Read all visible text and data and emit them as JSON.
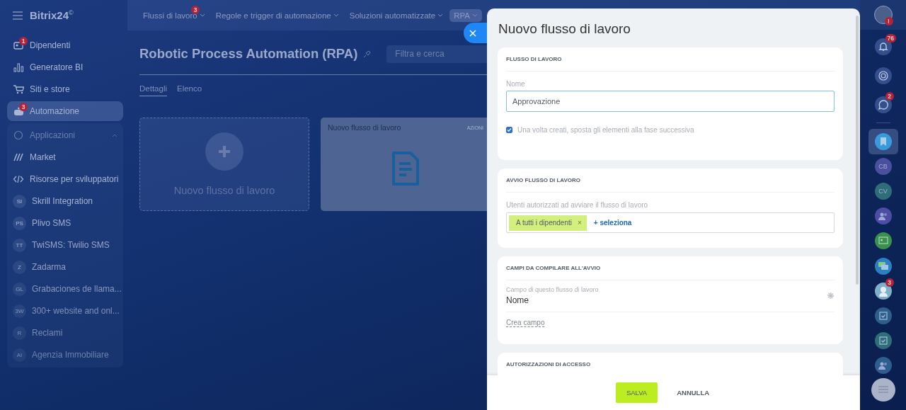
{
  "logo": {
    "name": "Bitrix24",
    "mark": "©"
  },
  "sidebar": {
    "items": [
      {
        "label": "Dipendenti",
        "badge": "1",
        "selected": false
      },
      {
        "label": "Generatore BI",
        "selected": false
      },
      {
        "label": "Siti e store",
        "selected": false
      },
      {
        "label": "Automazione",
        "badge": "3",
        "selected": true
      }
    ],
    "group": {
      "label": "Applicazioni",
      "expanded": true,
      "items": [
        {
          "label": "Market",
          "kind": "icon"
        },
        {
          "label": "Risorse per sviluppatori",
          "kind": "icon"
        },
        {
          "label": "Skrill Integration",
          "kind": "initials",
          "initials": "SI"
        },
        {
          "label": "Plivo SMS",
          "kind": "initials",
          "initials": "PS"
        },
        {
          "label": "TwiSMS: Twilio SMS",
          "kind": "initials",
          "initials": "TT"
        },
        {
          "label": "Zadarma",
          "kind": "initials",
          "initials": "Z"
        },
        {
          "label": "Grabaciones de llama...",
          "kind": "initials",
          "initials": "GL"
        },
        {
          "label": "300+ website and onl...",
          "kind": "initials",
          "initials": "3W"
        },
        {
          "label": "Reclami",
          "kind": "initials",
          "initials": "R"
        },
        {
          "label": "Agenzia Immobiliare",
          "kind": "initials",
          "initials": "AI"
        }
      ]
    }
  },
  "top_nav": [
    {
      "label": "Flussi di lavoro",
      "badge": "3",
      "selected": false
    },
    {
      "label": "Regole e trigger di automazione",
      "selected": false
    },
    {
      "label": "Soluzioni automatizzate",
      "selected": false
    },
    {
      "label": "RPA",
      "selected": true
    }
  ],
  "page": {
    "title": "Robotic Process Automation (RPA)",
    "search": {
      "placeholder": "Filtra e cerca"
    },
    "tabs": [
      {
        "label": "Dettagli",
        "selected": true
      },
      {
        "label": "Elenco",
        "selected": false
      }
    ],
    "add_card": {
      "label": "Nuovo flusso di lavoro"
    },
    "workflow_card": {
      "title": "Nuovo flusso di lavoro",
      "actions": "AZIONI"
    }
  },
  "panel": {
    "title": "Nuovo flusso di lavoro",
    "sections": [
      {
        "kind": "name",
        "title": "FLUSSO DI LAVORO",
        "label": "Nome",
        "value": "Approvazione",
        "checkbox": {
          "label": "Una volta creati, sposta gli elementi alla fase successiva",
          "checked": true
        }
      },
      {
        "kind": "users",
        "title": "AVVIO FLUSSO DI LAVORO",
        "label": "Utenti autorizzati ad avviare il flusso di lavoro",
        "tags": [
          "A tutti i dipendenti"
        ],
        "remove": "×",
        "add": "+ seleziona"
      },
      {
        "kind": "fields",
        "title": "CAMPI DA COMPILARE ALL'AVVIO",
        "field_caption": "Campo di questo flusso di lavoro",
        "field_name": "Nome",
        "create": "Crea campo"
      },
      {
        "kind": "title_only",
        "title": "AUTORIZZAZIONI DI ACCESSO"
      }
    ],
    "buttons": [
      {
        "label": "SALVA",
        "kind": "primary"
      },
      {
        "label": "ANNULLA",
        "kind": "link"
      }
    ]
  },
  "right_rail": {
    "profile_badge": "!",
    "items": [
      {
        "kind": "bell",
        "badge": "76",
        "selected": false
      },
      {
        "kind": "spiral",
        "selected": false
      },
      {
        "kind": "chat",
        "badge": "2",
        "selected": false
      },
      {
        "kind": "bookmark",
        "selected": true,
        "color": "#3a9ad9"
      },
      {
        "kind": "initials",
        "text": "CB",
        "selected": false,
        "color": "#4a4f9e"
      },
      {
        "kind": "initials",
        "text": "CV",
        "selected": false,
        "color": "#2f6e78"
      },
      {
        "kind": "group",
        "selected": false,
        "color": "#4c4ea3"
      },
      {
        "kind": "card",
        "selected": false,
        "color": "#3b8f4f"
      },
      {
        "kind": "bubbles",
        "selected": false,
        "color": "#2c7fc0"
      },
      {
        "kind": "avatar",
        "badge": "3",
        "selected": false,
        "color": "#7fb0c9"
      },
      {
        "kind": "task",
        "selected": false,
        "color": "#2e5f8c"
      },
      {
        "kind": "task",
        "selected": false,
        "color": "#2f6e78"
      },
      {
        "kind": "group",
        "selected": false,
        "color": "#2e5f8c"
      }
    ]
  }
}
